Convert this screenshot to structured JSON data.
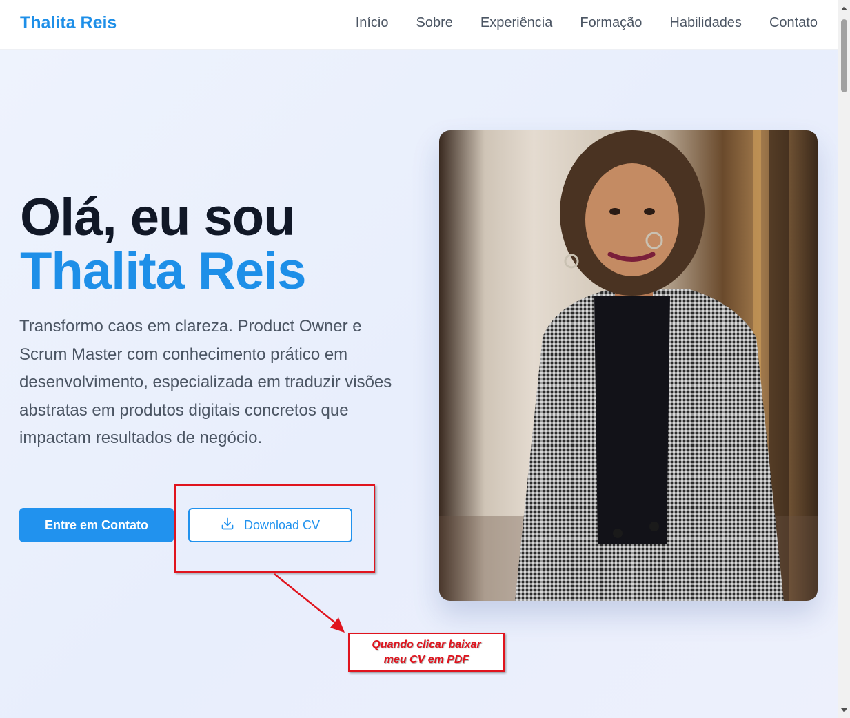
{
  "nav": {
    "brand": "Thalita Reis",
    "links": [
      "Início",
      "Sobre",
      "Experiência",
      "Formação",
      "Habilidades",
      "Contato"
    ]
  },
  "hero": {
    "greeting": "Olá, eu sou",
    "name": "Thalita Reis",
    "description": "Transformo caos em clareza. Product Owner e Scrum Master com conhecimento prático em desenvolvimento, especializada em traduzir visões abstratas em produtos digitais concretos que impactam resultados de negócio.",
    "contact_button": "Entre em Contato",
    "download_button": "Download CV"
  },
  "annotation": {
    "line1": "Quando clicar baixar",
    "line2": "meu CV em PDF"
  },
  "colors": {
    "accent": "#2192ee",
    "brand": "#1e8fe8",
    "annotation": "#e0141e"
  }
}
